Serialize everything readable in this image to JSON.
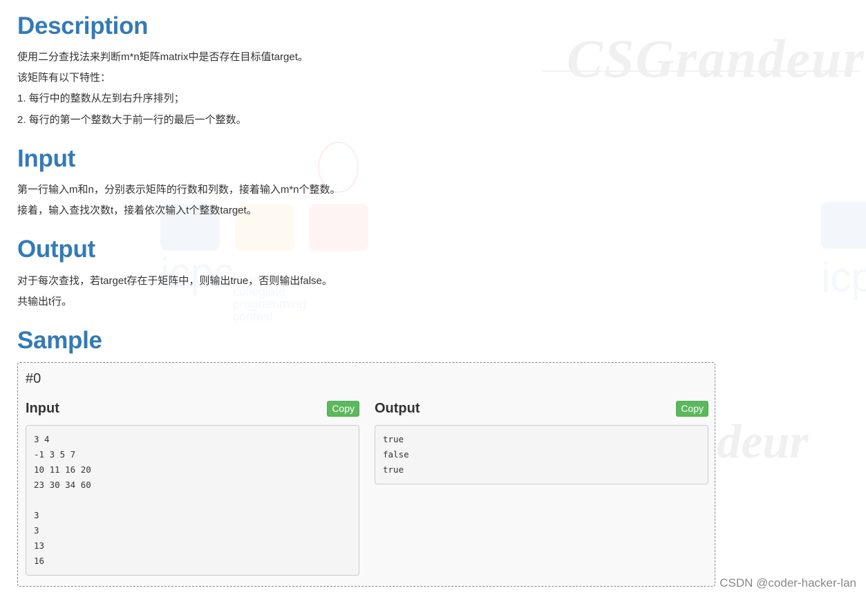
{
  "watermarks": {
    "brand": "CSGrandeur",
    "contest_logo": "icpc",
    "contest_tagline_1": "International collegiate",
    "contest_tagline_2": "programming contest"
  },
  "sections": {
    "description": {
      "title": "Description",
      "lines": [
        "使用二分查找法来判断m*n矩阵matrix中是否存在目标值target。",
        "该矩阵有以下特性：",
        "1. 每行中的整数从左到右升序排列；",
        "2. 每行的第一个整数大于前一行的最后一个整数。"
      ]
    },
    "input": {
      "title": "Input",
      "lines": [
        "第一行输入m和n，分别表示矩阵的行数和列数，接着输入m*n个整数。",
        "接着，输入查找次数t，接着依次输入t个整数target。"
      ]
    },
    "output": {
      "title": "Output",
      "lines": [
        "对于每次查找，若target存在于矩阵中，则输出true，否则输出false。",
        "共输出t行。"
      ]
    },
    "sample": {
      "title": "Sample",
      "case_id": "#0",
      "input": {
        "label": "Input",
        "copy_label": "Copy",
        "text": "3 4\n-1 3 5 7\n10 11 16 20\n23 30 34 60\n\n3\n3\n13\n16"
      },
      "output": {
        "label": "Output",
        "copy_label": "Copy",
        "text": "true\nfalse\ntrue"
      }
    }
  },
  "footer": {
    "credit": "CSDN @coder-hacker-lan"
  },
  "colors": {
    "heading": "#337ab7",
    "copy_button": "#5cb85c"
  }
}
